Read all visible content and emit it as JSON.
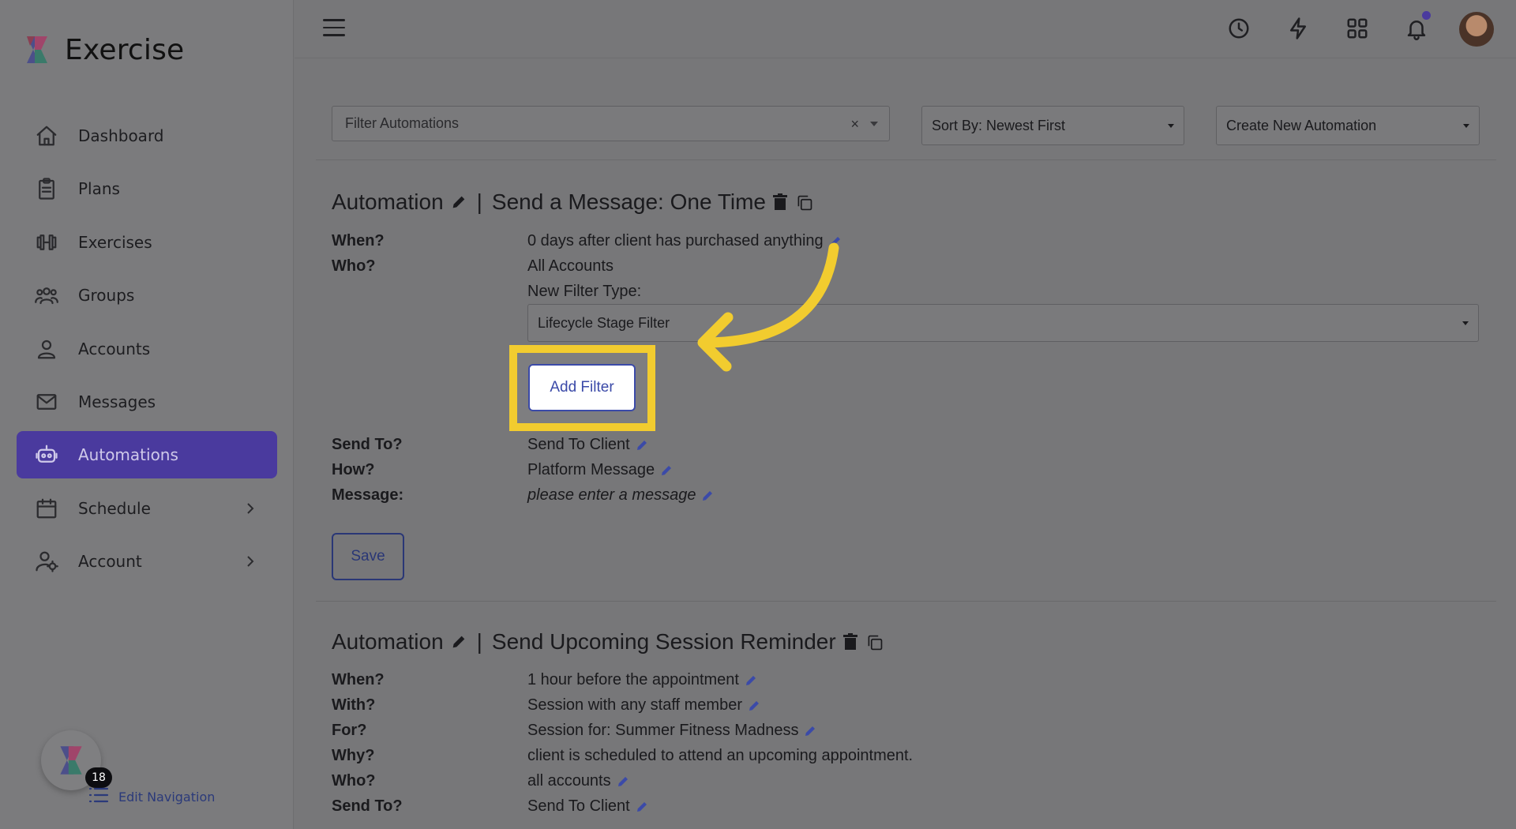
{
  "app": {
    "name": "Exercise"
  },
  "sidebar": {
    "items": [
      {
        "label": "Dashboard",
        "icon": "home-icon"
      },
      {
        "label": "Plans",
        "icon": "clipboard-icon"
      },
      {
        "label": "Exercises",
        "icon": "dumbbell-icon"
      },
      {
        "label": "Groups",
        "icon": "users-icon"
      },
      {
        "label": "Accounts",
        "icon": "user-icon"
      },
      {
        "label": "Messages",
        "icon": "mail-icon"
      },
      {
        "label": "Automations",
        "icon": "robot-icon",
        "active": true
      },
      {
        "label": "Schedule",
        "icon": "calendar-icon",
        "expandable": true
      },
      {
        "label": "Account",
        "icon": "user-gear-icon",
        "expandable": true
      }
    ],
    "helper_badge": "18",
    "edit_navigation": "Edit Navigation"
  },
  "toolbar": {
    "filter_placeholder": "Filter Automations",
    "clear_symbol": "×",
    "sort_label": "Sort By: Newest First",
    "create_label": "Create New Automation"
  },
  "automation1": {
    "prefix": "Automation",
    "separator": "|",
    "title": "Send a Message: One Time",
    "when_label": "When?",
    "when_value": "0 days after client has purchased anything",
    "who_label": "Who?",
    "who_value": "All Accounts",
    "new_filter_label": "New Filter Type:",
    "filter_type": "Lifecycle Stage Filter",
    "add_filter": "Add Filter",
    "send_to_label": "Send To?",
    "send_to_value": "Send To Client",
    "how_label": "How?",
    "how_value": "Platform Message",
    "message_label": "Message:",
    "message_value": "please enter a message",
    "save": "Save"
  },
  "automation2": {
    "prefix": "Automation",
    "separator": "|",
    "title": "Send Upcoming Session Reminder",
    "when_label": "When?",
    "when_value": "1 hour before the appointment",
    "with_label": "With?",
    "with_value": "Session with any staff member",
    "for_label": "For?",
    "for_value": "Session for: Summer Fitness Madness",
    "why_label": "Why?",
    "why_value": "client is scheduled to attend an upcoming appointment.",
    "who_label": "Who?",
    "who_value": "all accounts",
    "send_to_label": "Send To?",
    "send_to_value": "Send To Client"
  },
  "colors": {
    "accent": "#4a3a9e",
    "highlight": "#f2cc2f",
    "link": "#3b4aa8"
  }
}
